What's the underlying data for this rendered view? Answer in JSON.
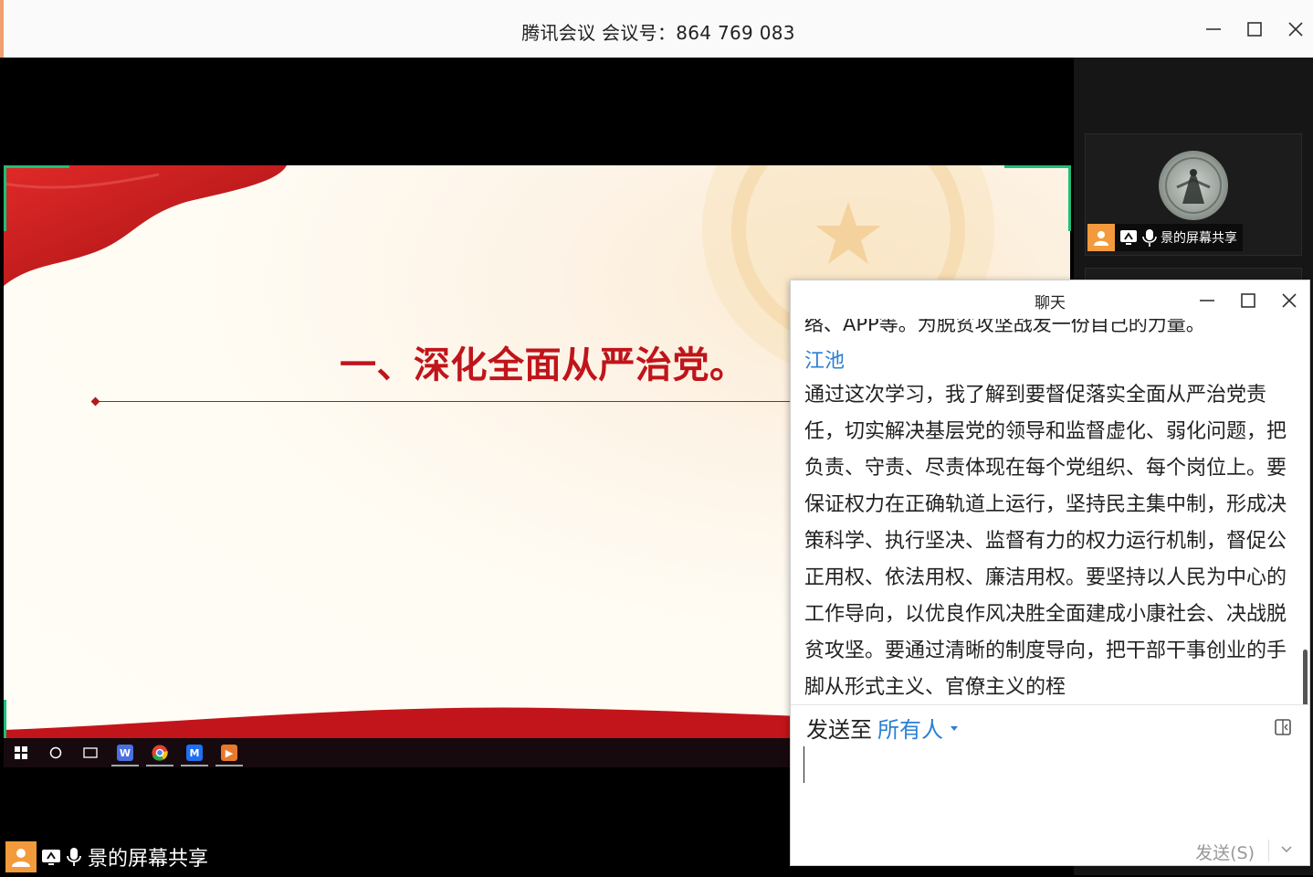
{
  "window": {
    "title": "腾讯会议 会议号：864 769 083"
  },
  "slide": {
    "title": "一、深化全面从严治党。"
  },
  "taskbar": {
    "items": [
      "windows-start",
      "search-circle",
      "task-view",
      "wps-app",
      "chrome-app",
      "tencent-meeting-app",
      "media-player-app"
    ]
  },
  "sharer": {
    "name": "景的屏幕共享"
  },
  "participant_tile": {
    "name": "景的屏幕共享"
  },
  "chat": {
    "title": "聊天",
    "partial_line": "络、APP等。为脱贫攻坚战发一份自己的力量。",
    "message": {
      "author": "江池",
      "text": "通过这次学习，我了解到要督促落实全面从严治党责任，切实解决基层党的领导和监督虚化、弱化问题，把负责、守责、尽责体现在每个党组织、每个岗位上。要保证权力在正确轨道上运行，坚持民主集中制，形成决策科学、执行坚决、监督有力的权力运行机制，督促公正用权、依法用权、廉洁用权。要坚持以人民为中心的工作导向，以优良作风决胜全面建成小康社会、决战脱贫攻坚。要通过清晰的制度导向，把干部干事创业的手脚从形式主义、官僚主义的桎"
    },
    "send_to_label": "发送至",
    "send_target": "所有人",
    "send_button": "发送(S)"
  },
  "colors": {
    "accent_blue": "#2a7fd4",
    "slide_red": "#c0141b",
    "avatar_orange": "#f39a3c",
    "share_border_green": "#1fbf7a"
  }
}
